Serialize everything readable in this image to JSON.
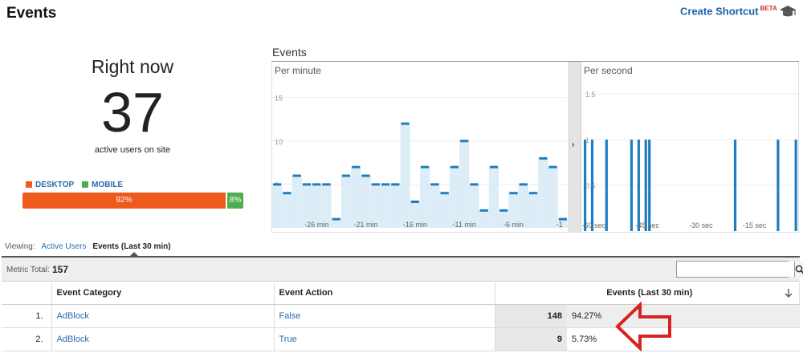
{
  "header": {
    "title": "Events",
    "shortcut_label": "Create Shortcut",
    "shortcut_badge": "BETA",
    "cap_icon": "graduation-cap-icon"
  },
  "right_now": {
    "label": "Right now",
    "count": "37",
    "subtitle": "active users on site",
    "legend": [
      {
        "label": "DESKTOP",
        "color": "#f0591c"
      },
      {
        "label": "MOBILE",
        "color": "#4cb050"
      }
    ],
    "desktop_pct_label": "92%",
    "mobile_pct_label": "8%",
    "desktop_share": 0.92
  },
  "events_chart": {
    "title": "Events",
    "expand_icon": "chevron-right-icon"
  },
  "chart_data": [
    {
      "type": "bar",
      "title": "Per minute",
      "yticks": [
        "15",
        "10",
        "5"
      ],
      "ylim": [
        0,
        17
      ],
      "xtick_labels": [
        "-26 min",
        "-21 min",
        "-16 min",
        "-11 min",
        "-6 min",
        "-1"
      ],
      "values": [
        5,
        4,
        6,
        5,
        5,
        5,
        1,
        6,
        7,
        6,
        5,
        5,
        5,
        12,
        3,
        7,
        5,
        4,
        7,
        10,
        5,
        2,
        7,
        2,
        4,
        5,
        4,
        8,
        7,
        1
      ]
    },
    {
      "type": "bar",
      "title": "Per second",
      "yticks": [
        "1.5",
        "1",
        "0.5"
      ],
      "ylim": [
        0,
        1.65
      ],
      "xtick_labels": [
        "-60 sec",
        "-45 sec",
        "-30 sec",
        "-15 sec"
      ],
      "bar_count": 60,
      "bars_at": [
        0,
        2,
        6,
        13,
        15,
        17,
        18,
        42,
        54,
        59
      ],
      "bar_value": 1
    }
  ],
  "viewing": {
    "label": "Viewing:",
    "options": [
      "Active Users",
      "Events (Last 30 min)"
    ]
  },
  "table": {
    "metric_total_label": "Metric Total:",
    "metric_total_value": "157",
    "search_placeholder": "",
    "headers": [
      "Event Category",
      "Event Action",
      "Events (Last 30 min)"
    ],
    "rows": [
      {
        "num": "1.",
        "category": "AdBlock",
        "action": "False",
        "events": "148",
        "pct": "94.27%"
      },
      {
        "num": "2.",
        "category": "AdBlock",
        "action": "True",
        "events": "9",
        "pct": "5.73%"
      }
    ]
  },
  "colors": {
    "link": "#2a6cb0",
    "bar_line": "#1e7ec0",
    "bar_fill": "#dcedf7",
    "annotation": "#d92323"
  }
}
